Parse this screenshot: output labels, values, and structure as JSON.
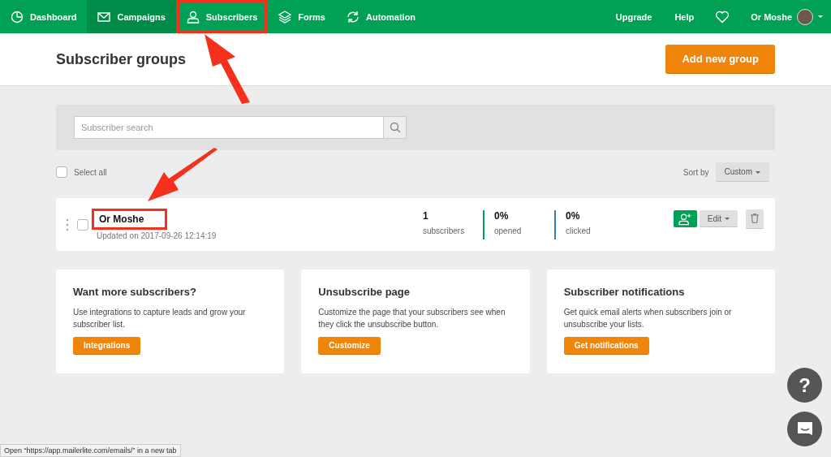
{
  "nav": {
    "items": [
      {
        "label": "Dashboard",
        "selected": false,
        "highlighted": false
      },
      {
        "label": "Campaigns",
        "selected": true,
        "highlighted": false
      },
      {
        "label": "Subscribers",
        "selected": false,
        "highlighted": true
      },
      {
        "label": "Forms",
        "selected": false,
        "highlighted": false
      },
      {
        "label": "Automation",
        "selected": false,
        "highlighted": false
      }
    ],
    "right": [
      {
        "kind": "link",
        "label": "Upgrade"
      },
      {
        "kind": "link",
        "label": "Help"
      },
      {
        "kind": "heart"
      },
      {
        "kind": "user",
        "label": "Or Moshe"
      }
    ]
  },
  "header": {
    "title": "Subscriber groups",
    "button": "Add new group"
  },
  "search": {
    "placeholder": "Subscriber search"
  },
  "list_controls": {
    "select_all": {
      "label": "Select all",
      "checked": false
    },
    "sort_label": "Sort by",
    "sort_value": "Custom"
  },
  "groups": [
    {
      "name": "Or Moshe",
      "highlighted": true,
      "checked": false,
      "updated": "Updated on 2017-09-26 12:14:19",
      "stats": [
        {
          "value": "1",
          "label": "subscribers"
        },
        {
          "value": "0%",
          "label": "opened",
          "color": "#00a154"
        },
        {
          "value": "0%",
          "label": "clicked",
          "color": "#2a7fc0"
        }
      ],
      "edit": "Edit"
    }
  ],
  "cards": [
    {
      "title": "Want more subscribers?",
      "text": "Use integrations to capture leads and grow your subscriber list.",
      "button": "Integrations"
    },
    {
      "title": "Unsubscribe page",
      "text": "Customize the page that your subscribers see when they click the unsubscribe button.",
      "button": "Customize"
    },
    {
      "title": "Subscriber notifications",
      "text": "Get quick email alerts when subscribers join or unsubscribe your lists.",
      "button": "Get notifications"
    }
  ],
  "help_button": "?",
  "status_bar": "Open “https://app.mailerlite.com/emails/” in a new tab"
}
